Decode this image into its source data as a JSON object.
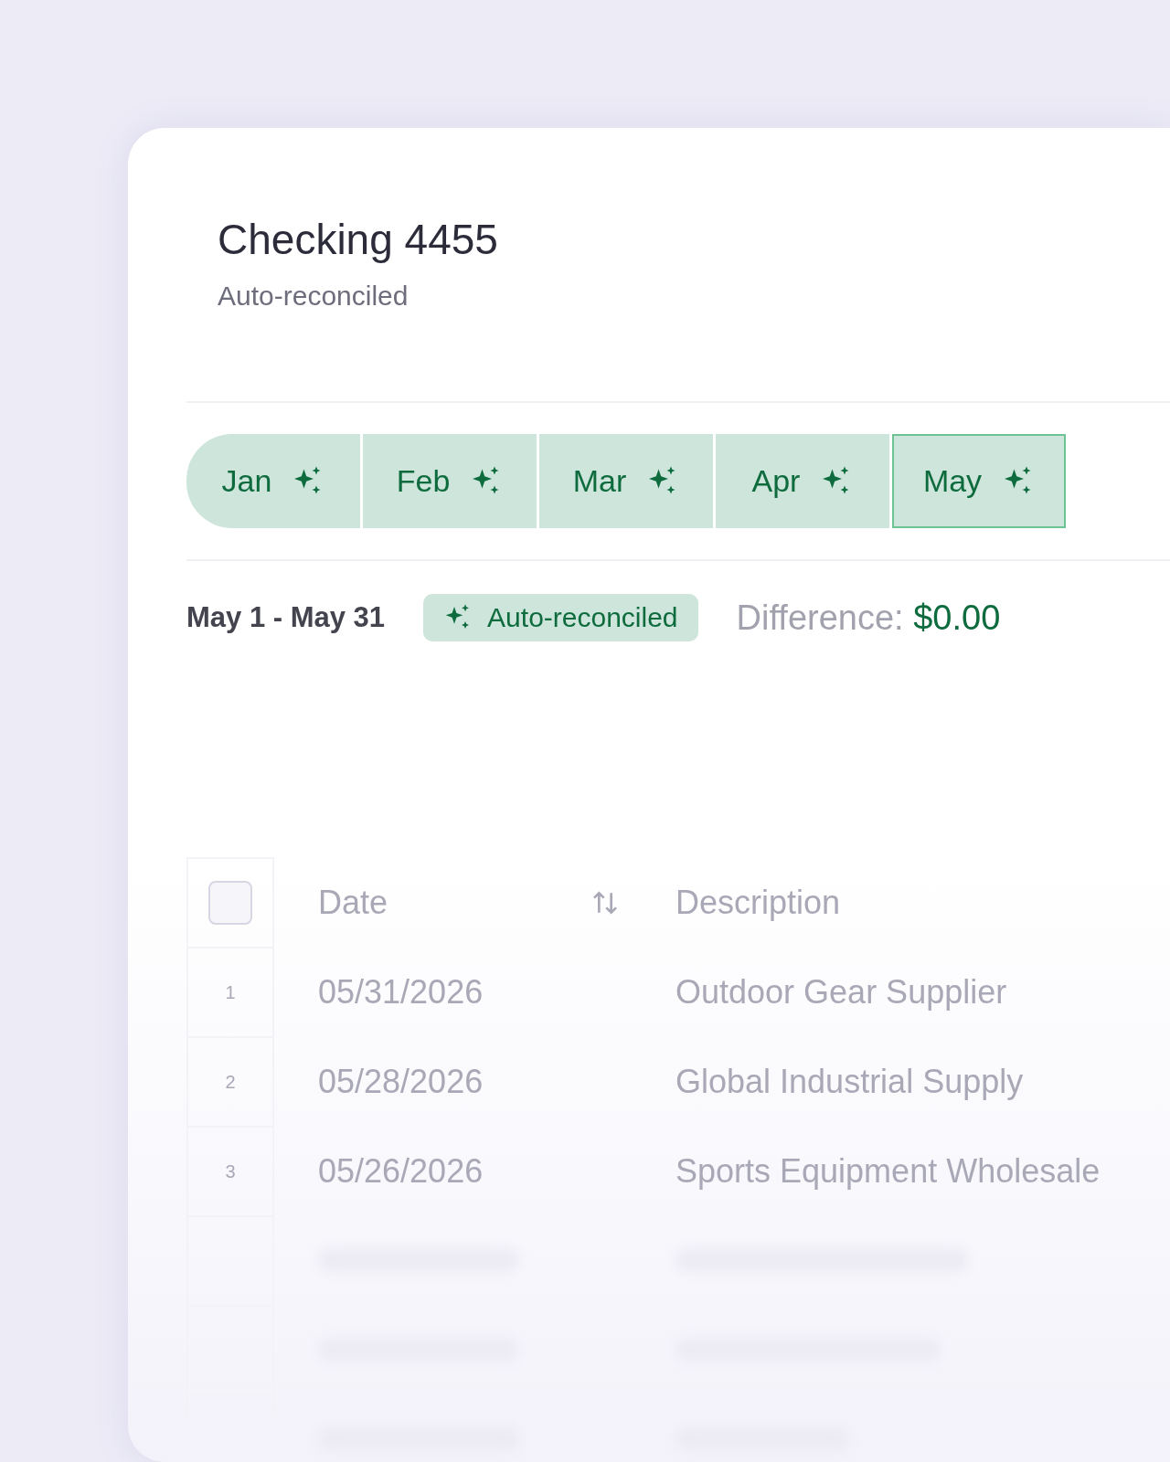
{
  "account": {
    "title": "Checking 4455",
    "subtitle": "Auto-reconciled"
  },
  "months": [
    {
      "label": "Jan",
      "selected": false
    },
    {
      "label": "Feb",
      "selected": false
    },
    {
      "label": "Mar",
      "selected": false
    },
    {
      "label": "Apr",
      "selected": false
    },
    {
      "label": "May",
      "selected": true
    }
  ],
  "period": {
    "range": "May 1 - May 31",
    "status": "Auto-reconciled",
    "difference_label": "Difference:",
    "difference_value": "$0.00"
  },
  "table": {
    "select_all_checked": false,
    "columns": [
      "Date",
      "Description"
    ],
    "rows": [
      {
        "index": "1",
        "date": "05/31/2026",
        "description": "Outdoor Gear Supplier"
      },
      {
        "index": "2",
        "date": "05/28/2026",
        "description": "Global Industrial Supply"
      },
      {
        "index": "3",
        "date": "05/26/2026",
        "description": "Sports Equipment Wholesale"
      }
    ]
  }
}
